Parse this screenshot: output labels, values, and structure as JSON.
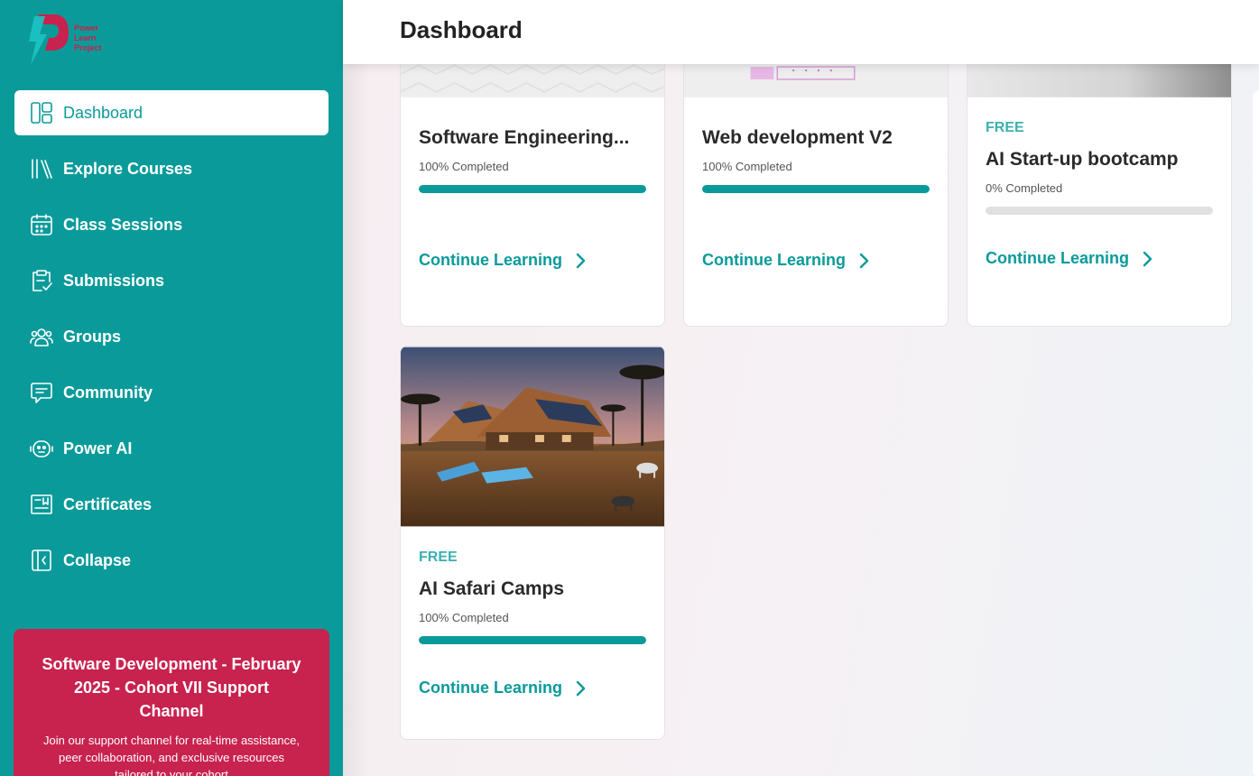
{
  "app": {
    "logo_lines": [
      "Power",
      "Learn",
      "Project"
    ],
    "page_title": "Dashboard"
  },
  "colors": {
    "primary": "#0b9a9a",
    "accent": "#c8224f"
  },
  "sidebar": {
    "items": [
      {
        "label": "Dashboard",
        "icon": "dashboard-icon",
        "active": true
      },
      {
        "label": "Explore Courses",
        "icon": "books-icon"
      },
      {
        "label": "Class Sessions",
        "icon": "calendar-icon"
      },
      {
        "label": "Submissions",
        "icon": "clipboard-check-icon"
      },
      {
        "label": "Groups",
        "icon": "users-icon"
      },
      {
        "label": "Community",
        "icon": "chat-icon"
      },
      {
        "label": "Power AI",
        "icon": "robot-icon"
      },
      {
        "label": "Certificates",
        "icon": "certificate-icon"
      },
      {
        "label": "Collapse",
        "icon": "collapse-icon"
      }
    ]
  },
  "support": {
    "title": "Software Development - February 2025 - Cohort VII Support Channel",
    "description": "Join our support channel for real-time assistance, peer collaboration, and exclusive resources tailored to your cohort"
  },
  "courses": [
    {
      "title": "Software Engineering...",
      "tag": "",
      "progress_label": "100% Completed",
      "progress": 1.0,
      "cta": "Continue Learning"
    },
    {
      "title": "Web development V2",
      "tag": "",
      "progress_label": "100% Completed",
      "progress": 1.0,
      "cta": "Continue Learning"
    },
    {
      "title": "AI Start-up bootcamp",
      "tag": "FREE",
      "progress_label": "0% Completed",
      "progress": 0.0,
      "cta": "Continue Learning"
    },
    {
      "title": "AI Safari Camps",
      "tag": "FREE",
      "progress_label": "100% Completed",
      "progress": 1.0,
      "cta": "Continue Learning"
    }
  ]
}
